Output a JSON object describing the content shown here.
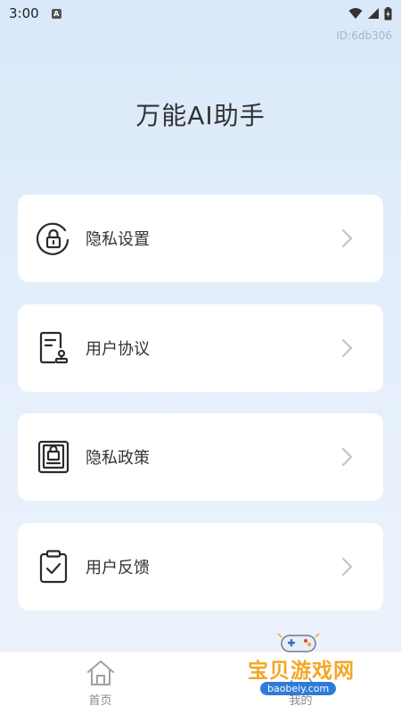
{
  "status_bar": {
    "time": "3:00",
    "notification_letter": "A"
  },
  "device_id": "ID:6db306",
  "app_title": "万能AI助手",
  "menu": [
    {
      "label": "隐私设置",
      "icon": "lock-circle-icon"
    },
    {
      "label": "用户协议",
      "icon": "document-stamp-icon"
    },
    {
      "label": "隐私政策",
      "icon": "lock-document-icon"
    },
    {
      "label": "用户反馈",
      "icon": "clipboard-check-icon"
    }
  ],
  "bottom_nav": {
    "home_label": "首页",
    "mine_label": "我的"
  },
  "watermark": {
    "title": "宝贝游戏网",
    "url": "baobeiy.com"
  }
}
